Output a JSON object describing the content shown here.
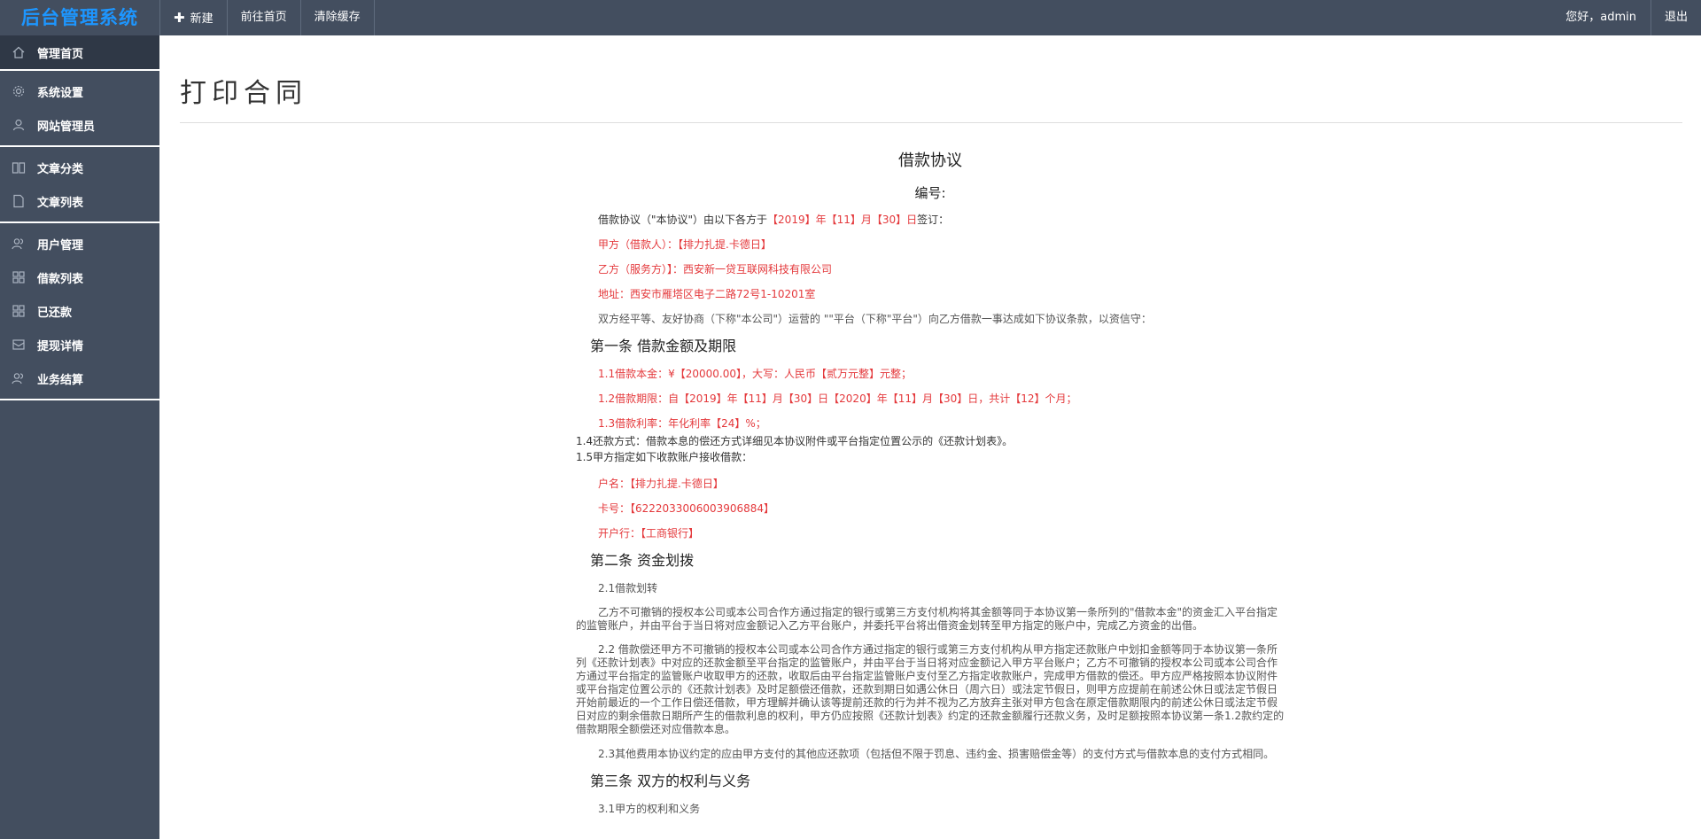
{
  "header": {
    "logo": "后台管理系统",
    "nav": [
      {
        "icon": "plus-icon",
        "label": "新建"
      },
      {
        "label": "前往首页"
      },
      {
        "label": "清除缓存"
      }
    ],
    "greeting": "您好，admin",
    "logout": "退出"
  },
  "sidebar": {
    "groups": [
      [
        {
          "label": "管理首页",
          "icon": "home-icon",
          "active": true
        }
      ],
      [
        {
          "label": "系统设置",
          "icon": "gear-icon"
        },
        {
          "label": "网站管理员",
          "icon": "user-icon"
        }
      ],
      [
        {
          "label": "文章分类",
          "icon": "book-icon"
        },
        {
          "label": "文章列表",
          "icon": "file-icon"
        }
      ],
      [
        {
          "label": "用户管理",
          "icon": "users-icon"
        },
        {
          "label": "借款列表",
          "icon": "grid-icon"
        },
        {
          "label": "已还款",
          "icon": "grid-icon"
        },
        {
          "label": "提现详情",
          "icon": "envelope-icon"
        },
        {
          "label": "业务结算",
          "icon": "users-icon"
        }
      ]
    ]
  },
  "page": {
    "title": "打印合同"
  },
  "contract": {
    "title": "借款协议",
    "number_label": "编号:",
    "intro_prefix": "借款协议（\"本协议\"）由以下各方于",
    "intro_date": "【2019】年【11】月【30】日",
    "intro_suffix": "签订：",
    "party_a": "甲方（借款人）：【排力扎提.卡德日】",
    "party_b": "乙方（服务方）】：西安新一贷互联网科技有限公司",
    "address": "地址：西安市雁塔区电子二路72号1-10201室",
    "preamble": "双方经平等、友好协商（下称\"本公司\"）运营的 \"\"平台（下称\"平台\"）向乙方借款一事达成如下协议条款，以资信守：",
    "section1": "第一条 借款金额及期限",
    "s1_1": "1.1借款本金：¥【20000.00】，大写：人民币【贰万元整】元整；",
    "s1_2": "1.2借款期限：自【2019】年【11】月【30】日【2020】年【11】月【30】日，共计【12】个月；",
    "s1_3": "1.3借款利率：年化利率【24】%；",
    "s1_4": "1.4还款方式：借款本息的偿还方式详细见本协议附件或平台指定位置公示的《还款计划表》。",
    "s1_5": "1.5甲方指定如下收款账户接收借款：",
    "account_name": "户名：【排力扎提.卡德日】",
    "card_no": "卡号：【6222033006003906884】",
    "bank": "开户行：【工商银行】",
    "section2": "第二条 资金划拨",
    "s2_1_title": "2.1借款划转",
    "s2_1_body": "乙方不可撤销的授权本公司或本公司合作方通过指定的银行或第三方支付机构将其金额等同于本协议第一条所列的\"借款本金\"的资金汇入平台指定的监管账户，并由平台于当日将对应金额记入乙方平台账户，并委托平台将出借资金划转至甲方指定的账户中，完成乙方资金的出借。",
    "s2_2_body": "2.2 借款偿还甲方不可撤销的授权本公司或本公司合作方通过指定的银行或第三方支付机构从甲方指定还款账户中划扣金额等同于本协议第一条所列《还款计划表》中对应的还款金额至平台指定的监管账户，并由平台于当日将对应金额记入甲方平台账户；乙方不可撤销的授权本公司或本公司合作方通过平台指定的监管账户收取甲方的还款，收取后由平台指定监管账户支付至乙方指定收款账户，完成甲方借款的偿还。甲方应严格按照本协议附件或平台指定位置公示的《还款计划表》及时足额偿还借款，还款到期日如遇公休日（周六日）或法定节假日，则甲方应提前在前述公休日或法定节假日开始前最近的一个工作日偿还借款，甲方理解并确认该等提前还款的行为并不视为乙方放弃主张对甲方包含在原定借款期限内的前述公休日或法定节假日对应的剩余借款日期所产生的借款利息的权利，甲方仍应按照《还款计划表》约定的还款金额履行还款义务，及时足额按照本协议第一条1.2款约定的借款期限全额偿还对应借款本息。",
    "s2_3_body": "2.3其他费用本协议约定的应由甲方支付的其他应还款项（包括但不限于罚息、违约金、损害赔偿金等）的支付方式与借款本息的支付方式相同。",
    "section3": "第三条 双方的权利与义务",
    "s3_1_title": "3.1甲方的权利和义务"
  }
}
